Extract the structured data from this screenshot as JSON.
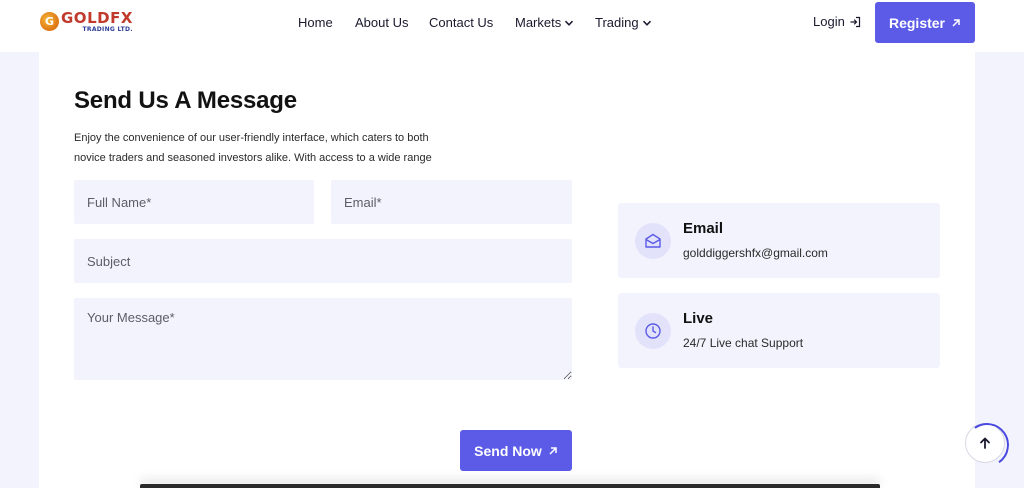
{
  "header": {
    "logo": {
      "name": "GOLDFX",
      "sub": "TRADING LTD."
    },
    "nav": [
      {
        "label": "Home"
      },
      {
        "label": "About Us"
      },
      {
        "label": "Contact Us"
      },
      {
        "label": "Markets",
        "dropdown": true
      },
      {
        "label": "Trading",
        "dropdown": true
      }
    ],
    "login_label": "Login",
    "register_label": "Register"
  },
  "contact": {
    "title": "Send Us A Message",
    "description": "Enjoy the convenience of our user-friendly interface, which caters to both novice traders and seasoned investors alike. With access to a wide range",
    "form": {
      "full_name_placeholder": "Full Name*",
      "email_placeholder": "Email*",
      "subject_placeholder": "Subject",
      "message_placeholder": "Your Message*",
      "send_label": "Send Now"
    },
    "info": [
      {
        "icon": "envelope-icon",
        "title": "Email",
        "text": "golddiggershfx@gmail.com"
      },
      {
        "icon": "clock-icon",
        "title": "Live",
        "text": "24/7 Live chat Support"
      }
    ]
  },
  "colors": {
    "accent": "#5b5be8",
    "field_bg": "#f3f3fd",
    "page_bg": "#f3f3fd"
  }
}
